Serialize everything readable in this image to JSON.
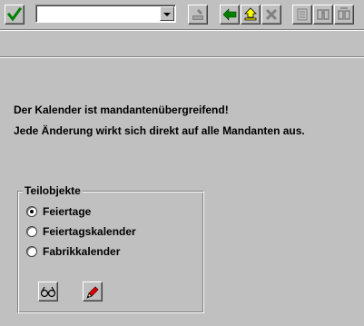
{
  "toolbar": {
    "enter_icon": "check-icon",
    "command_field": {
      "value": "",
      "placeholder": ""
    },
    "buttons": [
      "save-icon",
      "back-icon",
      "exit-icon",
      "cancel-icon",
      "print-icon",
      "find-icon",
      "find-next-icon"
    ]
  },
  "message": {
    "line1": "Der Kalender ist mandantenübergreifend!",
    "line2": "Jede Änderung wirkt sich direkt auf alle Mandanten aus."
  },
  "group": {
    "title": "Teilobjekte",
    "options": [
      {
        "label": "Feiertage",
        "checked": true
      },
      {
        "label": "Feiertagskalender",
        "checked": false
      },
      {
        "label": "Fabrikkalender",
        "checked": false
      }
    ],
    "display_icon": "glasses-icon",
    "change_icon": "pencil-icon"
  },
  "colors": {
    "background": "#c0c0c0",
    "check_green": "#008000",
    "pencil_red": "#e00000"
  }
}
